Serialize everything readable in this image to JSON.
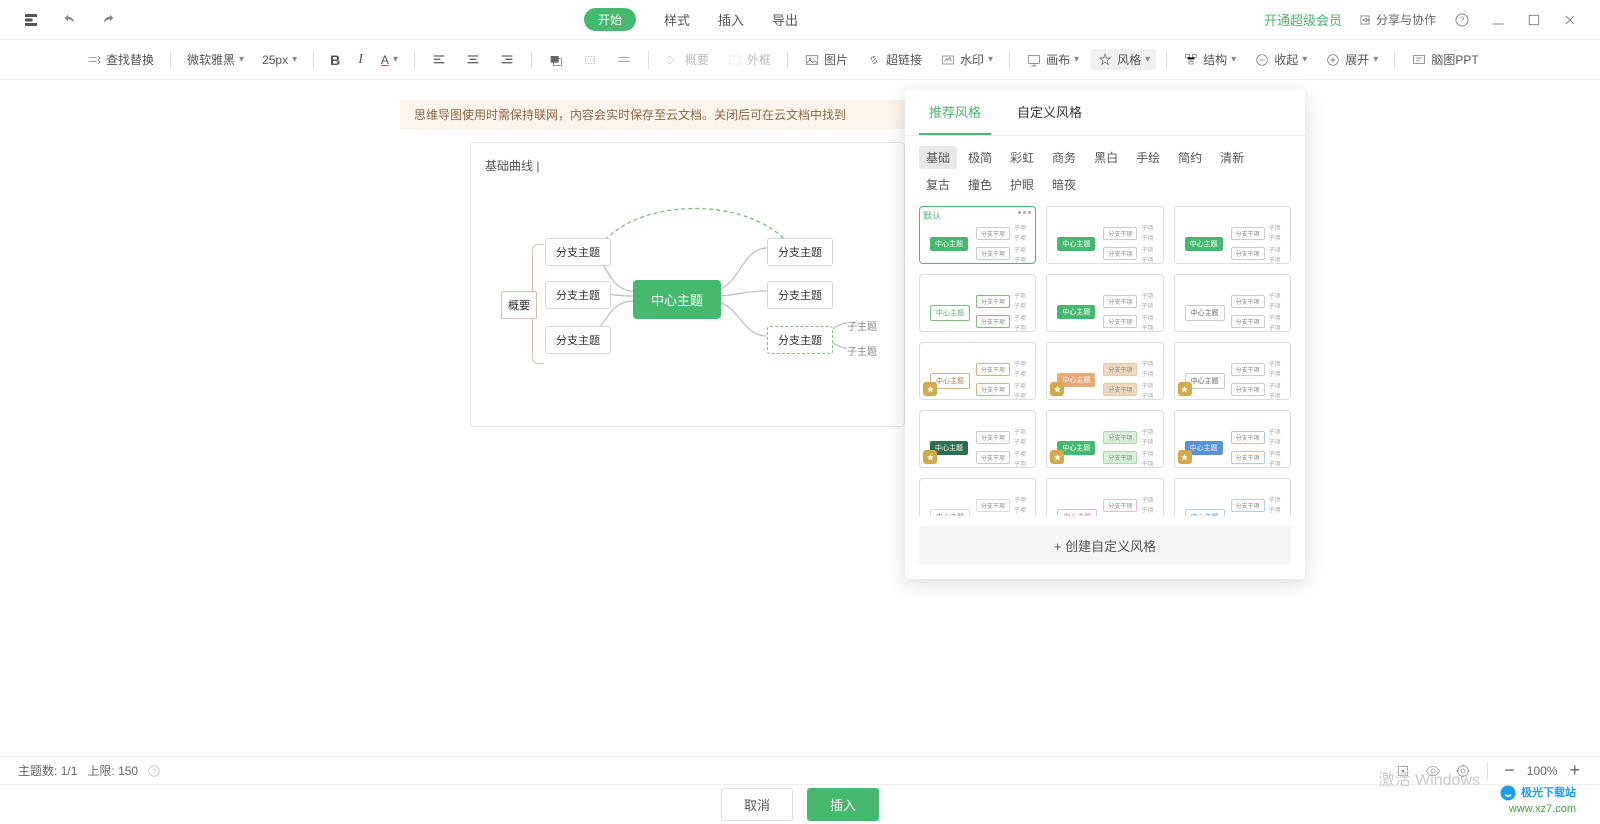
{
  "topbar": {
    "tabs": {
      "start": "开始",
      "style": "样式",
      "insert": "插入",
      "export": "导出"
    },
    "member": "开通超级会员",
    "share": "分享与协作"
  },
  "toolbar": {
    "findReplace": "查找替换",
    "font": "微软雅黑",
    "fontSize": "25px",
    "summary": "概要",
    "border": "外框",
    "image": "图片",
    "hyperlink": "超链接",
    "watermark": "水印",
    "canvas": "画布",
    "style": "风格",
    "structure": "结构",
    "collapse": "收起",
    "expand": "展开",
    "mindPPT": "脑图PPT"
  },
  "banner": "思维导图使用时需保持联网，内容会实时保存至云文档。关闭后可在云文档中找到",
  "mindmap": {
    "title": "基础曲线 |",
    "center": "中心主题",
    "note": "概要",
    "branch": "分支主题",
    "sub": "子主题"
  },
  "panel": {
    "tab1": "推荐风格",
    "tab2": "自定义风格",
    "cats": [
      "基础",
      "极简",
      "彩虹",
      "商务",
      "黑白",
      "手绘",
      "简约",
      "清新",
      "复古",
      "撞色",
      "护眼",
      "暗夜"
    ],
    "defaultBadge": "默认",
    "thumbRoot": "中心主题",
    "thumbNode": "分支干项",
    "thumbLeaf": "子项",
    "create": "+ 创建自定义风格"
  },
  "status": {
    "topicLabel": "主题数:",
    "topicVal": "1/1",
    "limitLabel": "上限:",
    "limitVal": "150",
    "zoom": "100%"
  },
  "footer": {
    "cancel": "取消",
    "insert": "插入"
  },
  "wm": {
    "brand": "极光下载站",
    "url": "www.xz7.com",
    "activate": "激活 Windows"
  }
}
